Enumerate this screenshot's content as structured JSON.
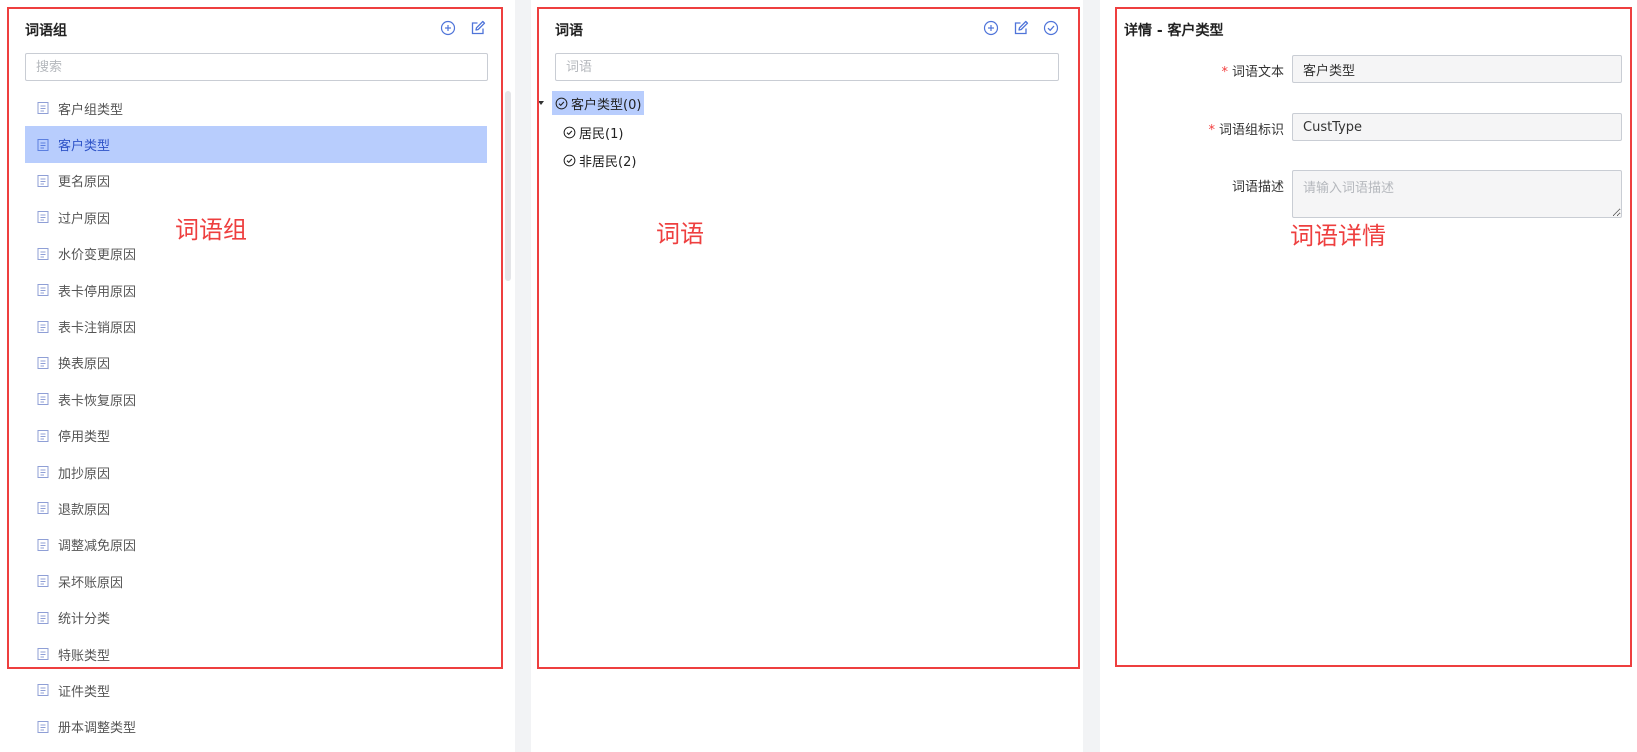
{
  "colors": {
    "accent": "#4f74d9",
    "selected_bg": "#b8cdfd",
    "annotation_red": "#ee3f3f",
    "required_star": "#f23c3c"
  },
  "group_panel": {
    "title": "词语组",
    "search_placeholder": "搜索",
    "icons": [
      "plus-circle-icon",
      "edit-icon"
    ],
    "items": [
      {
        "label": "客户组类型",
        "selected": false
      },
      {
        "label": "客户类型",
        "selected": true
      },
      {
        "label": "更名原因",
        "selected": false
      },
      {
        "label": "过户原因",
        "selected": false
      },
      {
        "label": "水价变更原因",
        "selected": false
      },
      {
        "label": "表卡停用原因",
        "selected": false
      },
      {
        "label": "表卡注销原因",
        "selected": false
      },
      {
        "label": "换表原因",
        "selected": false
      },
      {
        "label": "表卡恢复原因",
        "selected": false
      },
      {
        "label": "停用类型",
        "selected": false
      },
      {
        "label": "加抄原因",
        "selected": false
      },
      {
        "label": "退款原因",
        "selected": false
      },
      {
        "label": "调整减免原因",
        "selected": false
      },
      {
        "label": "呆坏账原因",
        "selected": false
      },
      {
        "label": "统计分类",
        "selected": false
      },
      {
        "label": "特账类型",
        "selected": false
      },
      {
        "label": "证件类型",
        "selected": false
      },
      {
        "label": "册本调整类型",
        "selected": false
      }
    ]
  },
  "word_panel": {
    "title": "词语",
    "search_placeholder": "词语",
    "icons": [
      "plus-circle-icon",
      "edit-icon",
      "check-circle-icon"
    ],
    "tree": {
      "root": {
        "label": "客户类型(0)",
        "expanded": true,
        "selected": true
      },
      "children": [
        {
          "label": "居民(1)"
        },
        {
          "label": "非居民(2)"
        }
      ]
    }
  },
  "detail_panel": {
    "title": "详情 - 客户类型",
    "fields": [
      {
        "label": "词语文本",
        "required": true,
        "value": "客户类型"
      },
      {
        "label": "词语组标识",
        "required": true,
        "value": "CustType"
      },
      {
        "label": "词语描述",
        "required": false,
        "value": "",
        "placeholder": "请输入词语描述"
      }
    ],
    "required_mark": "*"
  },
  "annotations": {
    "group_label": "词语组",
    "word_label": "词语",
    "detail_label": "词语详情"
  }
}
